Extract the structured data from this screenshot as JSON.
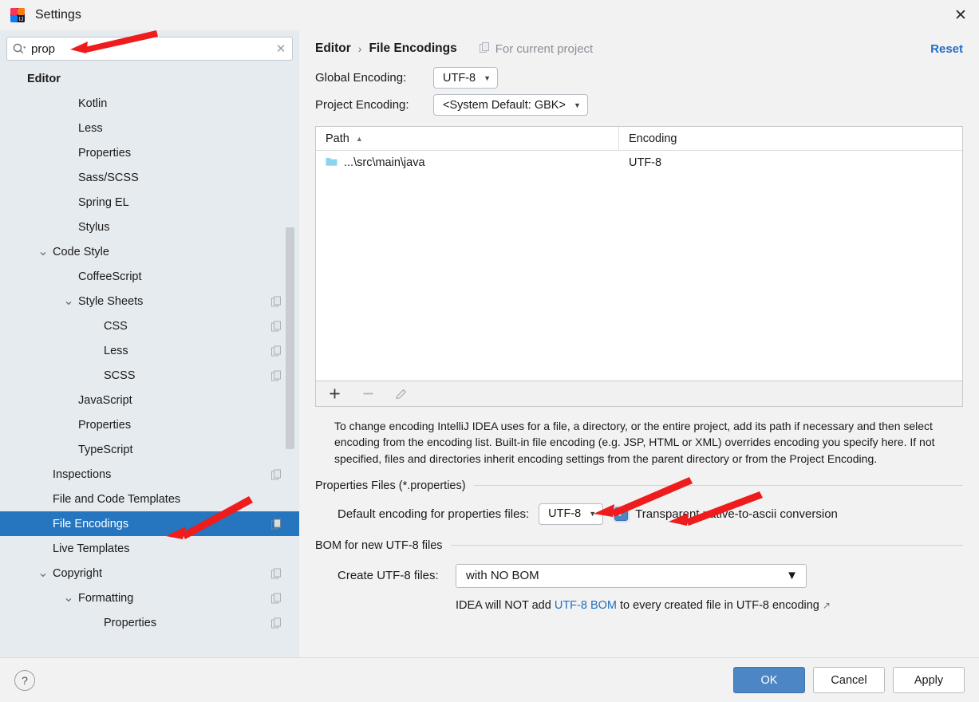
{
  "window": {
    "title": "Settings",
    "logo_icon": "intellij-idea-logo",
    "close_icon": "close-icon"
  },
  "sidebar": {
    "search": {
      "value": "prop",
      "placeholder": "",
      "icon": "search-icon",
      "clear_icon": "clear-icon"
    },
    "items": [
      {
        "label": "Editor",
        "indent": 0,
        "bold": true,
        "arrow": "",
        "badge": false,
        "selected": false
      },
      {
        "label": "Kotlin",
        "indent": 2,
        "bold": false,
        "arrow": "",
        "badge": false,
        "selected": false
      },
      {
        "label": "Less",
        "indent": 2,
        "bold": false,
        "arrow": "",
        "badge": false,
        "selected": false
      },
      {
        "label": "Properties",
        "indent": 2,
        "bold": false,
        "arrow": "",
        "badge": false,
        "selected": false
      },
      {
        "label": "Sass/SCSS",
        "indent": 2,
        "bold": false,
        "arrow": "",
        "badge": false,
        "selected": false
      },
      {
        "label": "Spring EL",
        "indent": 2,
        "bold": false,
        "arrow": "",
        "badge": false,
        "selected": false
      },
      {
        "label": "Stylus",
        "indent": 2,
        "bold": false,
        "arrow": "",
        "badge": false,
        "selected": false
      },
      {
        "label": "Code Style",
        "indent": 1,
        "bold": false,
        "arrow": "v",
        "badge": false,
        "selected": false
      },
      {
        "label": "CoffeeScript",
        "indent": 2,
        "bold": false,
        "arrow": "",
        "badge": false,
        "selected": false
      },
      {
        "label": "Style Sheets",
        "indent": 2,
        "bold": false,
        "arrow": "v",
        "badge": true,
        "selected": false
      },
      {
        "label": "CSS",
        "indent": 3,
        "bold": false,
        "arrow": "",
        "badge": true,
        "selected": false
      },
      {
        "label": "Less",
        "indent": 3,
        "bold": false,
        "arrow": "",
        "badge": true,
        "selected": false
      },
      {
        "label": "SCSS",
        "indent": 3,
        "bold": false,
        "arrow": "",
        "badge": true,
        "selected": false
      },
      {
        "label": "JavaScript",
        "indent": 2,
        "bold": false,
        "arrow": "",
        "badge": false,
        "selected": false
      },
      {
        "label": "Properties",
        "indent": 2,
        "bold": false,
        "arrow": "",
        "badge": false,
        "selected": false
      },
      {
        "label": "TypeScript",
        "indent": 2,
        "bold": false,
        "arrow": "",
        "badge": false,
        "selected": false
      },
      {
        "label": "Inspections",
        "indent": 1,
        "bold": false,
        "arrow": "",
        "badge": true,
        "selected": false
      },
      {
        "label": "File and Code Templates",
        "indent": 1,
        "bold": false,
        "arrow": "",
        "badge": false,
        "selected": false
      },
      {
        "label": "File Encodings",
        "indent": 1,
        "bold": false,
        "arrow": "",
        "badge": true,
        "selected": true
      },
      {
        "label": "Live Templates",
        "indent": 1,
        "bold": false,
        "arrow": "",
        "badge": false,
        "selected": false
      },
      {
        "label": "Copyright",
        "indent": 1,
        "bold": false,
        "arrow": "v",
        "badge": true,
        "selected": false
      },
      {
        "label": "Formatting",
        "indent": 2,
        "bold": false,
        "arrow": "v",
        "badge": true,
        "selected": false
      },
      {
        "label": "Properties",
        "indent": 3,
        "bold": false,
        "arrow": "",
        "badge": true,
        "selected": false
      }
    ]
  },
  "main": {
    "breadcrumb": {
      "parent": "Editor",
      "separator": "›",
      "current": "File Encodings"
    },
    "for_current_project": {
      "label": "For current project",
      "icon": "copy-scope-icon"
    },
    "reset_label": "Reset",
    "global_encoding": {
      "label": "Global Encoding:",
      "value": "UTF-8"
    },
    "project_encoding": {
      "label": "Project Encoding:",
      "value": "<System Default: GBK>"
    },
    "table": {
      "columns": [
        "Path",
        "Encoding"
      ],
      "sort_column": "Path",
      "sort_direction": "asc",
      "sort_caret": "▲",
      "rows": [
        {
          "path": "...\\src\\main\\java",
          "encoding": "UTF-8",
          "icon": "folder-icon"
        }
      ],
      "toolbar": [
        {
          "name": "add-button",
          "glyph": "+",
          "enabled": true
        },
        {
          "name": "remove-button",
          "glyph": "−",
          "enabled": false
        },
        {
          "name": "edit-button",
          "glyph": "pencil",
          "enabled": false
        }
      ]
    },
    "description": "To change encoding IntelliJ IDEA uses for a file, a directory, or the entire project, add its path if necessary and then select encoding from the encoding list. Built-in file encoding (e.g. JSP, HTML or XML) overrides encoding you specify here. If not specified, files and directories inherit encoding settings from the parent directory or from the Project Encoding.",
    "properties_group": {
      "title": "Properties Files (*.properties)",
      "default_encoding_label": "Default encoding for properties files:",
      "default_encoding_value": "UTF-8",
      "transparent_checkbox": {
        "label": "Transparent native-to-ascii conversion",
        "checked": true
      }
    },
    "bom_group": {
      "title": "BOM for new UTF-8 files",
      "create_label": "Create UTF-8 files:",
      "create_value": "with NO BOM",
      "hint_prefix": "IDEA will NOT add ",
      "hint_link": "UTF-8 BOM",
      "hint_suffix": " to every created file in UTF-8 encoding",
      "external_link_icon": "↗"
    }
  },
  "footer": {
    "help_label": "?",
    "ok_label": "OK",
    "cancel_label": "Cancel",
    "apply_label": "Apply"
  },
  "colors": {
    "selection_blue": "#2675bf",
    "primary_button": "#4d86c4",
    "link_blue": "#2470c2",
    "sidebar_bg": "#e6ebef",
    "panel_bg": "#f2f2f2",
    "annotation_red": "#ee1c1c"
  }
}
